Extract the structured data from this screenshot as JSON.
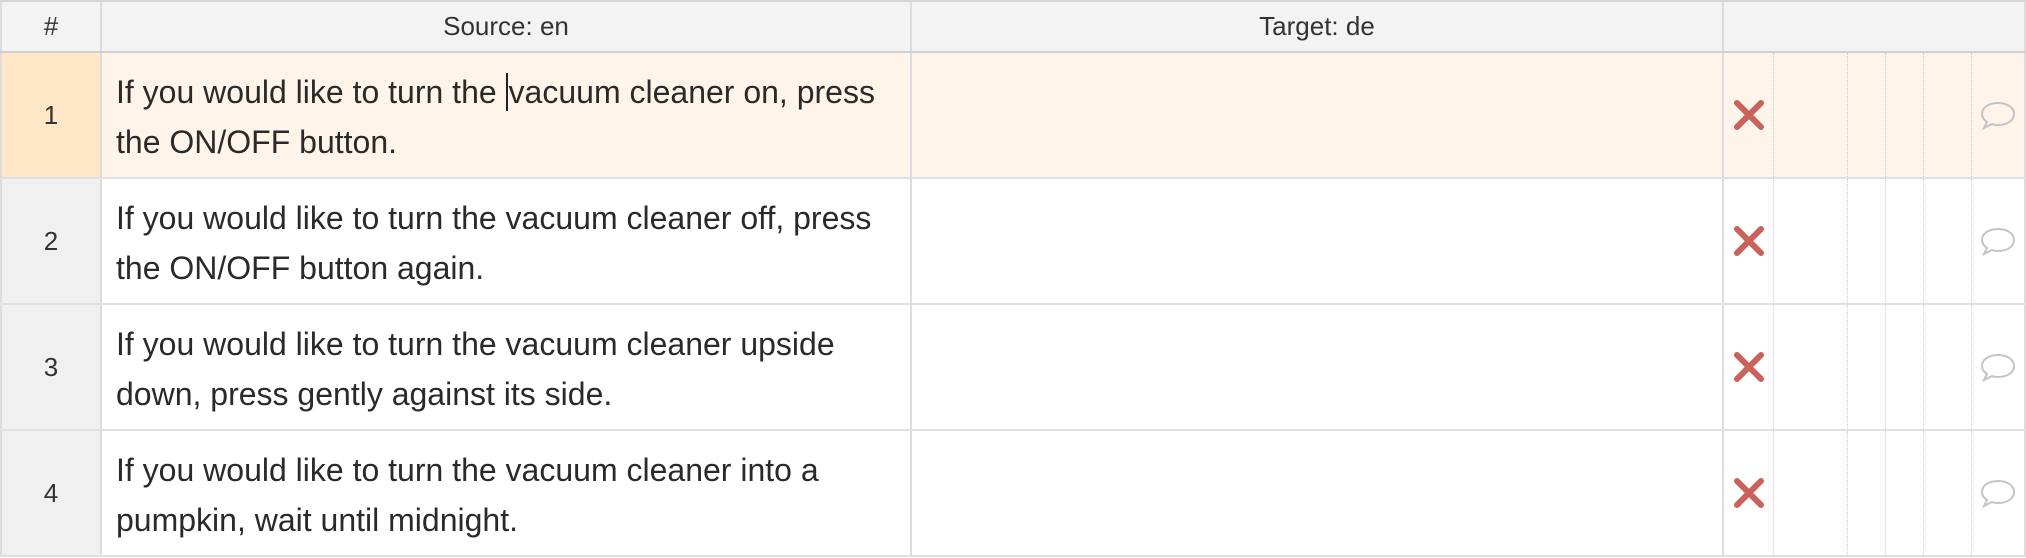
{
  "header": {
    "num_label": "#",
    "source_label": "Source: en",
    "target_label": "Target: de"
  },
  "rows": [
    {
      "num": "1",
      "source_before_caret": "If you would like to turn the ",
      "source_after_caret": "vacuum cleaner on, press the ON/OFF button.",
      "target": "",
      "active": true
    },
    {
      "num": "2",
      "source": "If you would like to turn the vacuum cleaner off, press the ON/OFF button again.",
      "target": ""
    },
    {
      "num": "3",
      "source": "If you would like to turn the vacuum cleaner upside down, press gently against its side.",
      "target": ""
    },
    {
      "num": "4",
      "source": "If you would like to turn the vacuum cleaner into a pumpkin, wait until midnight.",
      "target": ""
    }
  ],
  "icons": {
    "status": "x-mark-icon",
    "comment": "comment-bubble-icon"
  },
  "colors": {
    "active_row_bg": "#fff4ea",
    "active_num_bg": "#ffe7c8",
    "x_mark": "#c9625b"
  }
}
